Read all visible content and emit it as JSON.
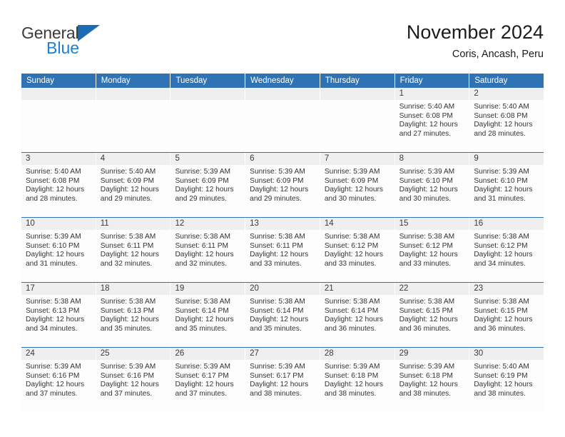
{
  "brand": {
    "name_part1": "General",
    "name_part2": "Blue",
    "flag_icon": "triangle-flag-icon",
    "color_dark": "#3b3b3b",
    "color_blue": "#1b7fd4"
  },
  "header": {
    "title": "November 2024",
    "subtitle": "Coris, Ancash, Peru"
  },
  "theme": {
    "header_blue": "#3073b4",
    "daynum_gray": "#efefef",
    "cell_white": "#fdfdfd"
  },
  "weekday_headers": [
    "Sunday",
    "Monday",
    "Tuesday",
    "Wednesday",
    "Thursday",
    "Friday",
    "Saturday"
  ],
  "weeks": [
    [
      {
        "day": "",
        "empty": true
      },
      {
        "day": "",
        "empty": true
      },
      {
        "day": "",
        "empty": true
      },
      {
        "day": "",
        "empty": true
      },
      {
        "day": "",
        "empty": true
      },
      {
        "day": "1",
        "sunrise": "Sunrise: 5:40 AM",
        "sunset": "Sunset: 6:08 PM",
        "daylight1": "Daylight: 12 hours",
        "daylight2": "and 27 minutes."
      },
      {
        "day": "2",
        "sunrise": "Sunrise: 5:40 AM",
        "sunset": "Sunset: 6:08 PM",
        "daylight1": "Daylight: 12 hours",
        "daylight2": "and 28 minutes."
      }
    ],
    [
      {
        "day": "3",
        "sunrise": "Sunrise: 5:40 AM",
        "sunset": "Sunset: 6:08 PM",
        "daylight1": "Daylight: 12 hours",
        "daylight2": "and 28 minutes."
      },
      {
        "day": "4",
        "sunrise": "Sunrise: 5:40 AM",
        "sunset": "Sunset: 6:09 PM",
        "daylight1": "Daylight: 12 hours",
        "daylight2": "and 29 minutes."
      },
      {
        "day": "5",
        "sunrise": "Sunrise: 5:39 AM",
        "sunset": "Sunset: 6:09 PM",
        "daylight1": "Daylight: 12 hours",
        "daylight2": "and 29 minutes."
      },
      {
        "day": "6",
        "sunrise": "Sunrise: 5:39 AM",
        "sunset": "Sunset: 6:09 PM",
        "daylight1": "Daylight: 12 hours",
        "daylight2": "and 29 minutes."
      },
      {
        "day": "7",
        "sunrise": "Sunrise: 5:39 AM",
        "sunset": "Sunset: 6:09 PM",
        "daylight1": "Daylight: 12 hours",
        "daylight2": "and 30 minutes."
      },
      {
        "day": "8",
        "sunrise": "Sunrise: 5:39 AM",
        "sunset": "Sunset: 6:10 PM",
        "daylight1": "Daylight: 12 hours",
        "daylight2": "and 30 minutes."
      },
      {
        "day": "9",
        "sunrise": "Sunrise: 5:39 AM",
        "sunset": "Sunset: 6:10 PM",
        "daylight1": "Daylight: 12 hours",
        "daylight2": "and 31 minutes."
      }
    ],
    [
      {
        "day": "10",
        "sunrise": "Sunrise: 5:39 AM",
        "sunset": "Sunset: 6:10 PM",
        "daylight1": "Daylight: 12 hours",
        "daylight2": "and 31 minutes."
      },
      {
        "day": "11",
        "sunrise": "Sunrise: 5:38 AM",
        "sunset": "Sunset: 6:11 PM",
        "daylight1": "Daylight: 12 hours",
        "daylight2": "and 32 minutes."
      },
      {
        "day": "12",
        "sunrise": "Sunrise: 5:38 AM",
        "sunset": "Sunset: 6:11 PM",
        "daylight1": "Daylight: 12 hours",
        "daylight2": "and 32 minutes."
      },
      {
        "day": "13",
        "sunrise": "Sunrise: 5:38 AM",
        "sunset": "Sunset: 6:11 PM",
        "daylight1": "Daylight: 12 hours",
        "daylight2": "and 33 minutes."
      },
      {
        "day": "14",
        "sunrise": "Sunrise: 5:38 AM",
        "sunset": "Sunset: 6:12 PM",
        "daylight1": "Daylight: 12 hours",
        "daylight2": "and 33 minutes."
      },
      {
        "day": "15",
        "sunrise": "Sunrise: 5:38 AM",
        "sunset": "Sunset: 6:12 PM",
        "daylight1": "Daylight: 12 hours",
        "daylight2": "and 33 minutes."
      },
      {
        "day": "16",
        "sunrise": "Sunrise: 5:38 AM",
        "sunset": "Sunset: 6:12 PM",
        "daylight1": "Daylight: 12 hours",
        "daylight2": "and 34 minutes."
      }
    ],
    [
      {
        "day": "17",
        "sunrise": "Sunrise: 5:38 AM",
        "sunset": "Sunset: 6:13 PM",
        "daylight1": "Daylight: 12 hours",
        "daylight2": "and 34 minutes."
      },
      {
        "day": "18",
        "sunrise": "Sunrise: 5:38 AM",
        "sunset": "Sunset: 6:13 PM",
        "daylight1": "Daylight: 12 hours",
        "daylight2": "and 35 minutes."
      },
      {
        "day": "19",
        "sunrise": "Sunrise: 5:38 AM",
        "sunset": "Sunset: 6:14 PM",
        "daylight1": "Daylight: 12 hours",
        "daylight2": "and 35 minutes."
      },
      {
        "day": "20",
        "sunrise": "Sunrise: 5:38 AM",
        "sunset": "Sunset: 6:14 PM",
        "daylight1": "Daylight: 12 hours",
        "daylight2": "and 35 minutes."
      },
      {
        "day": "21",
        "sunrise": "Sunrise: 5:38 AM",
        "sunset": "Sunset: 6:14 PM",
        "daylight1": "Daylight: 12 hours",
        "daylight2": "and 36 minutes."
      },
      {
        "day": "22",
        "sunrise": "Sunrise: 5:38 AM",
        "sunset": "Sunset: 6:15 PM",
        "daylight1": "Daylight: 12 hours",
        "daylight2": "and 36 minutes."
      },
      {
        "day": "23",
        "sunrise": "Sunrise: 5:38 AM",
        "sunset": "Sunset: 6:15 PM",
        "daylight1": "Daylight: 12 hours",
        "daylight2": "and 36 minutes."
      }
    ],
    [
      {
        "day": "24",
        "sunrise": "Sunrise: 5:39 AM",
        "sunset": "Sunset: 6:16 PM",
        "daylight1": "Daylight: 12 hours",
        "daylight2": "and 37 minutes."
      },
      {
        "day": "25",
        "sunrise": "Sunrise: 5:39 AM",
        "sunset": "Sunset: 6:16 PM",
        "daylight1": "Daylight: 12 hours",
        "daylight2": "and 37 minutes."
      },
      {
        "day": "26",
        "sunrise": "Sunrise: 5:39 AM",
        "sunset": "Sunset: 6:17 PM",
        "daylight1": "Daylight: 12 hours",
        "daylight2": "and 37 minutes."
      },
      {
        "day": "27",
        "sunrise": "Sunrise: 5:39 AM",
        "sunset": "Sunset: 6:17 PM",
        "daylight1": "Daylight: 12 hours",
        "daylight2": "and 38 minutes."
      },
      {
        "day": "28",
        "sunrise": "Sunrise: 5:39 AM",
        "sunset": "Sunset: 6:18 PM",
        "daylight1": "Daylight: 12 hours",
        "daylight2": "and 38 minutes."
      },
      {
        "day": "29",
        "sunrise": "Sunrise: 5:39 AM",
        "sunset": "Sunset: 6:18 PM",
        "daylight1": "Daylight: 12 hours",
        "daylight2": "and 38 minutes."
      },
      {
        "day": "30",
        "sunrise": "Sunrise: 5:40 AM",
        "sunset": "Sunset: 6:19 PM",
        "daylight1": "Daylight: 12 hours",
        "daylight2": "and 38 minutes."
      }
    ]
  ]
}
